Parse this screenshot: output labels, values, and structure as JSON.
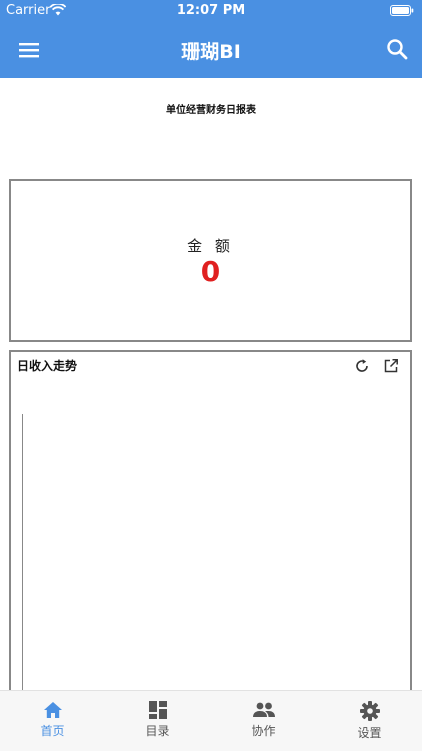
{
  "status_bar": {
    "carrier": "Carrier",
    "time": "12:07 PM"
  },
  "nav": {
    "title": "珊瑚BI",
    "menu_icon": "menu-icon",
    "search_icon": "search-icon"
  },
  "report": {
    "title": "单位经营财务日报表"
  },
  "amount_card": {
    "label": "金 额",
    "value": "0",
    "value_color": "#e02020"
  },
  "trend_card": {
    "title": "日收入走势",
    "icons": [
      "refresh-icon",
      "external-link-icon"
    ]
  },
  "tab_bar": {
    "tabs": [
      {
        "label": "首页",
        "icon": "home-icon",
        "active": true
      },
      {
        "label": "目录",
        "icon": "dashboard-icon",
        "active": false
      },
      {
        "label": "协作",
        "icon": "people-icon",
        "active": false
      },
      {
        "label": "设置",
        "icon": "gear-icon",
        "active": false
      }
    ]
  },
  "colors": {
    "accent": "#4a90e2",
    "active_tab": "#4a90e2",
    "inactive_tab": "#555555"
  }
}
